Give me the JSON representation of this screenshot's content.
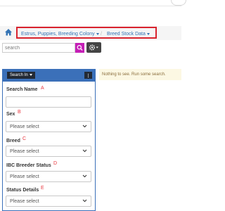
{
  "breadcrumb": {
    "items": [
      {
        "label": "Estrus, Puppies, Breeding Colony"
      },
      {
        "label": "Breed Stock Data"
      }
    ],
    "separator": "/"
  },
  "search": {
    "placeholder": "search",
    "value": ""
  },
  "search_panel": {
    "search_in_label": "Search In",
    "fields": [
      {
        "label": "Search Name",
        "annotation": "A",
        "type": "text",
        "value": ""
      },
      {
        "label": "Sex",
        "annotation": "B",
        "type": "select",
        "value": "Please select"
      },
      {
        "label": "Breed",
        "annotation": "C",
        "type": "select",
        "value": "Please select"
      },
      {
        "label": "IBC Breeder Status",
        "annotation": "D",
        "type": "select",
        "value": "Please select"
      },
      {
        "label": "Status Details",
        "annotation": "E",
        "type": "select",
        "value": "Please select"
      }
    ]
  },
  "results": {
    "empty_message": "Nothing to see. Run some search."
  },
  "colors": {
    "accent_blue": "#3b70b9",
    "search_button": "#c51fb6",
    "highlight_box": "#d9232e",
    "annotation_red": "#e8373f",
    "empty_bg": "#fcf8e3"
  }
}
